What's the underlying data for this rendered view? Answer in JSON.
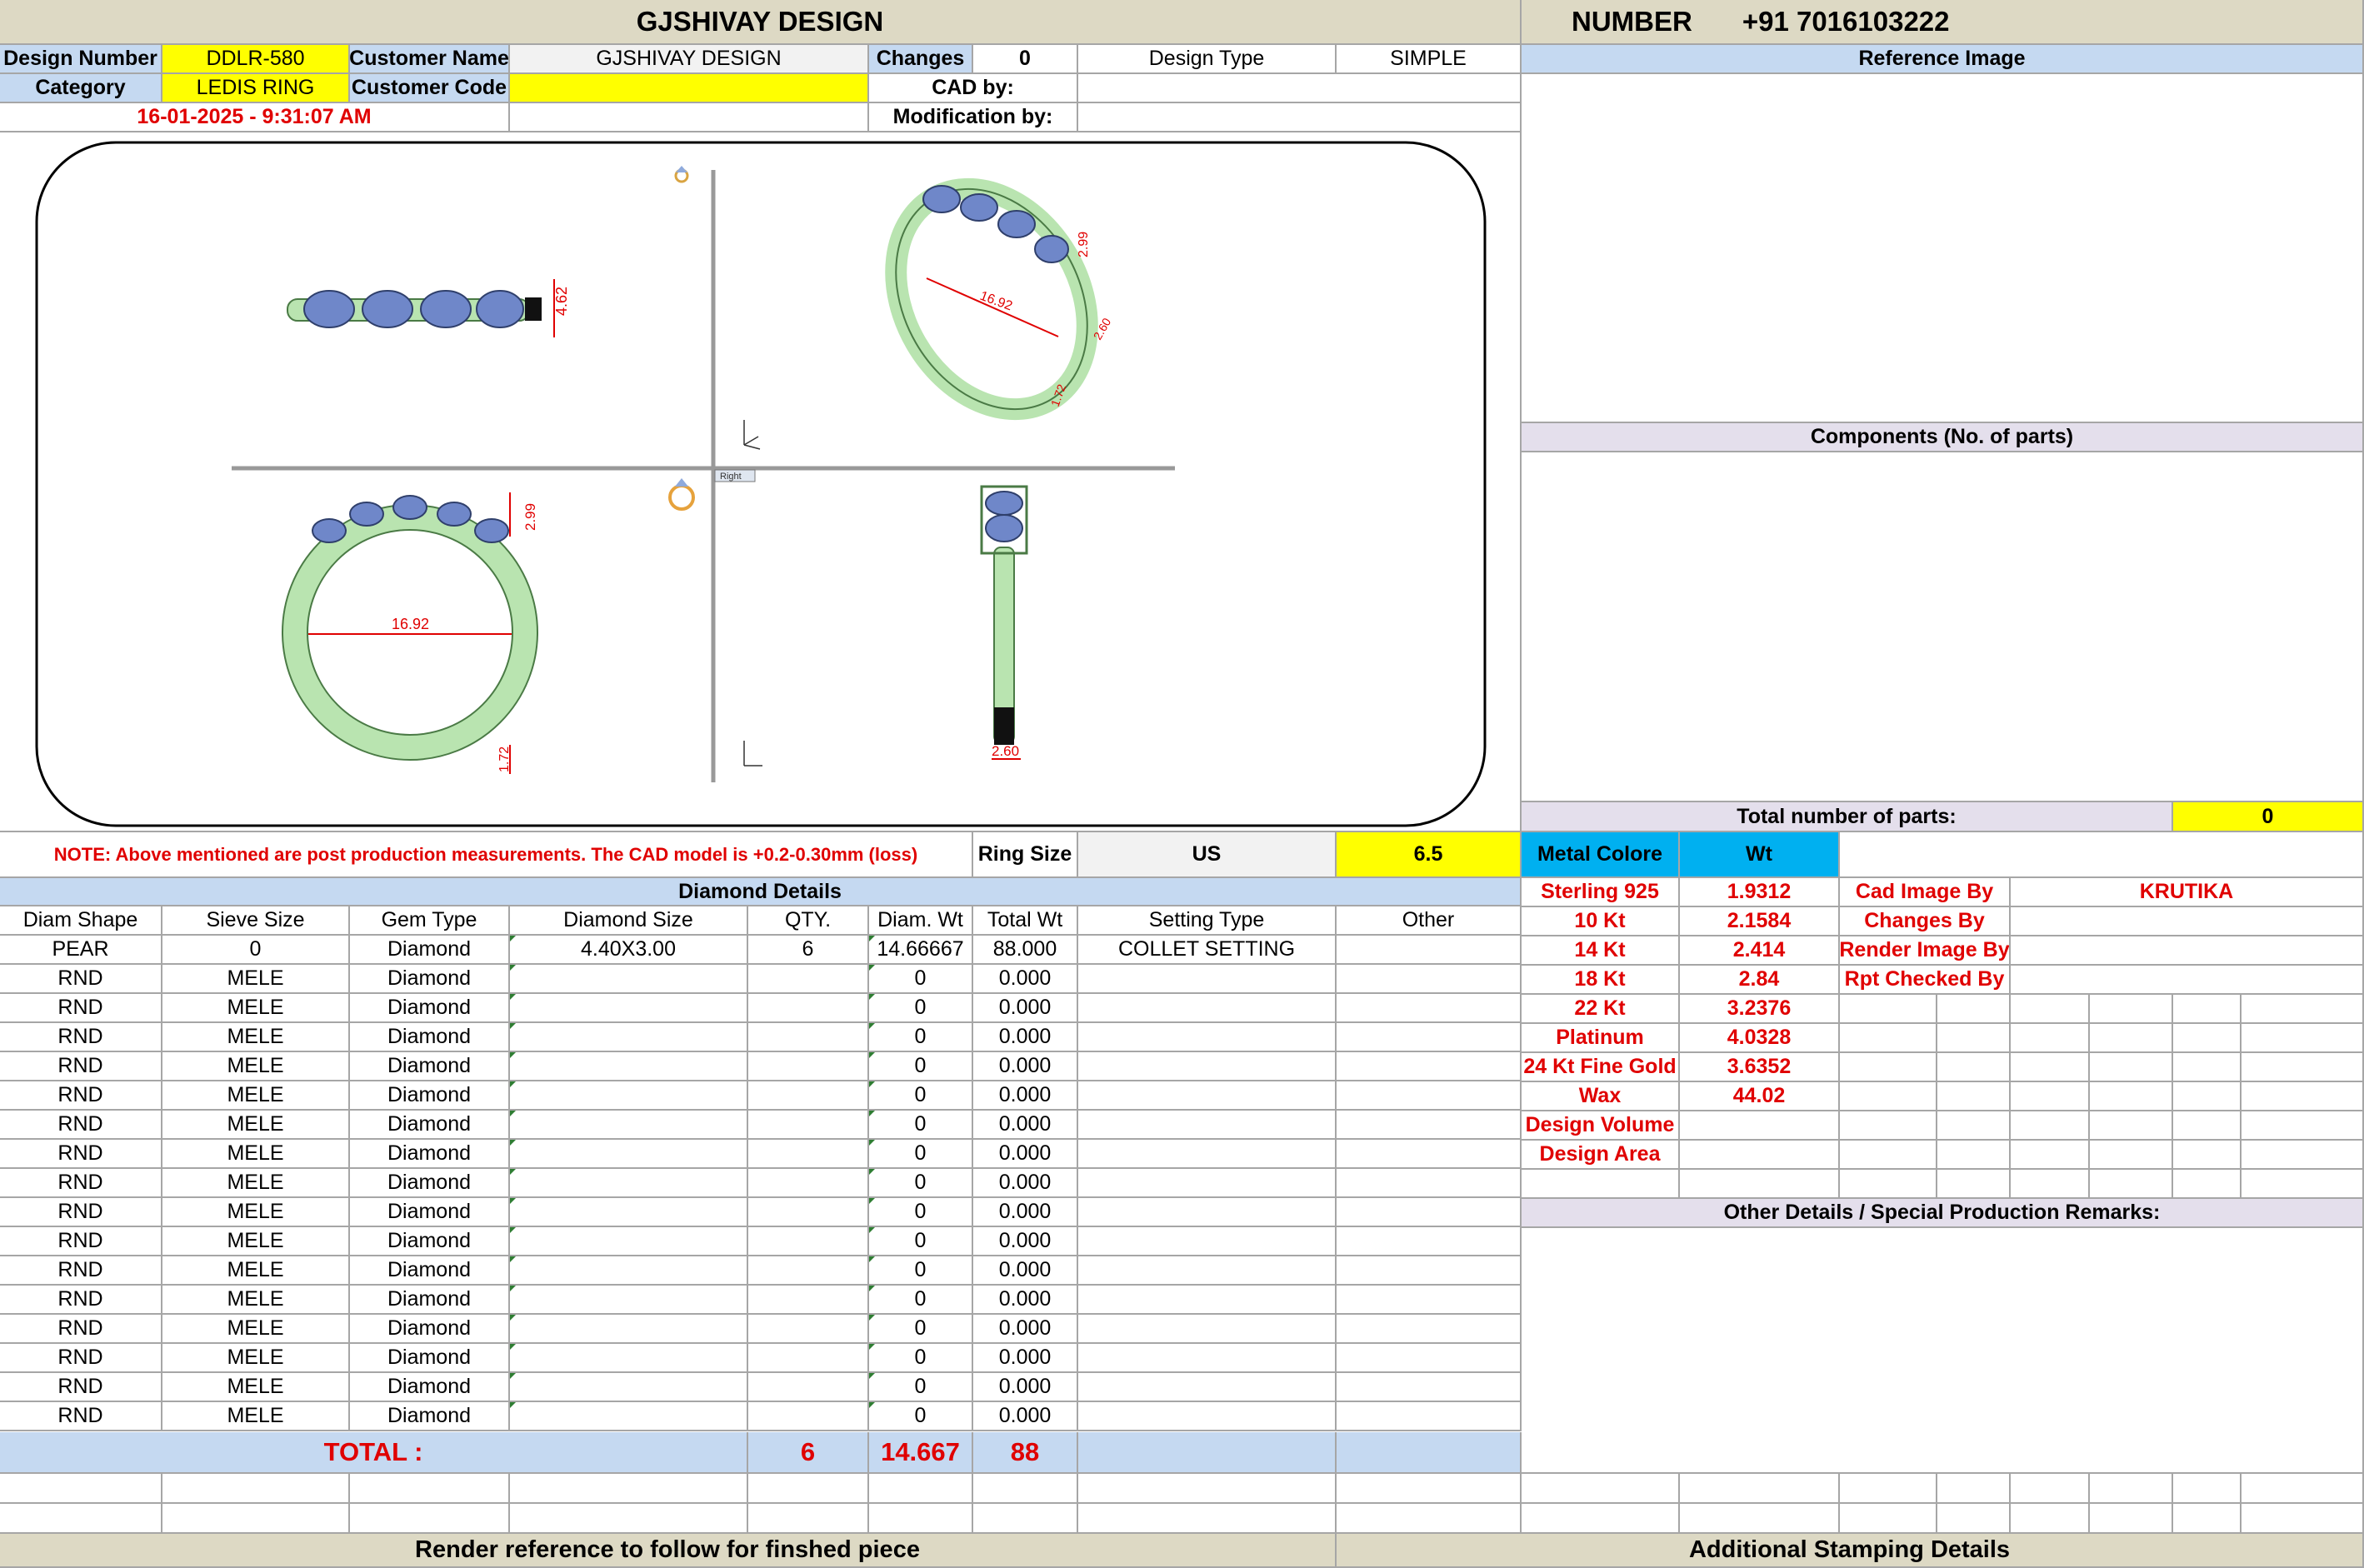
{
  "header": {
    "company": "GJSHIVAY DESIGN",
    "number_label": "NUMBER",
    "number_value": "+91 7016103222"
  },
  "info": {
    "design_number_label": "Design Number",
    "design_number": "DDLR-580",
    "customer_name_label": "Customer Name",
    "customer_name": "GJSHIVAY DESIGN",
    "changes_label": "Changes",
    "changes": "0",
    "design_type_label": "Design Type",
    "design_type": "SIMPLE",
    "category_label": "Category",
    "category": "LEDIS RING",
    "customer_code_label": "Customer Code",
    "cad_by_label": "CAD by:",
    "datetime": "16-01-2025 - 9:31:07 AM",
    "modification_by_label": "Modification by:"
  },
  "right_panel": {
    "reference_image": "Reference Image",
    "components": "Components (No. of parts)",
    "total_parts_label": "Total number of parts:",
    "total_parts": "0"
  },
  "drawing": {
    "dim_side_height": "4.62",
    "dim_persp_width": "16.92",
    "dim_persp_height": "2.99",
    "dim_persp_small": "2.60",
    "dim_persp_bottom": "1.72",
    "dim_front_diameter": "16.92",
    "dim_front_height": "2.99",
    "dim_front_bottom": "1.72",
    "dim_right_width": "2.60",
    "view_label": "Right"
  },
  "note": {
    "text": "NOTE: Above mentioned are post production measurements. The CAD model is +0.2-0.30mm (loss)",
    "ring_size_label": "Ring Size",
    "ring_size_unit": "US",
    "ring_size": "6.5"
  },
  "diamond": {
    "title": "Diamond Details",
    "headers": [
      "Diam Shape",
      "Sieve Size",
      "Gem Type",
      "Diamond Size",
      "QTY.",
      "Diam. Wt",
      "Total Wt",
      "Setting Type",
      "Other"
    ],
    "rows": [
      [
        "PEAR",
        "0",
        "Diamond",
        "4.40X3.00",
        "6",
        "14.66667",
        "88.000",
        "COLLET SETTING",
        ""
      ],
      [
        "RND",
        "MELE",
        "Diamond",
        "",
        "",
        "0",
        "0.000",
        "",
        ""
      ],
      [
        "RND",
        "MELE",
        "Diamond",
        "",
        "",
        "0",
        "0.000",
        "",
        ""
      ],
      [
        "RND",
        "MELE",
        "Diamond",
        "",
        "",
        "0",
        "0.000",
        "",
        ""
      ],
      [
        "RND",
        "MELE",
        "Diamond",
        "",
        "",
        "0",
        "0.000",
        "",
        ""
      ],
      [
        "RND",
        "MELE",
        "Diamond",
        "",
        "",
        "0",
        "0.000",
        "",
        ""
      ],
      [
        "RND",
        "MELE",
        "Diamond",
        "",
        "",
        "0",
        "0.000",
        "",
        ""
      ],
      [
        "RND",
        "MELE",
        "Diamond",
        "",
        "",
        "0",
        "0.000",
        "",
        ""
      ],
      [
        "RND",
        "MELE",
        "Diamond",
        "",
        "",
        "0",
        "0.000",
        "",
        ""
      ],
      [
        "RND",
        "MELE",
        "Diamond",
        "",
        "",
        "0",
        "0.000",
        "",
        ""
      ],
      [
        "RND",
        "MELE",
        "Diamond",
        "",
        "",
        "0",
        "0.000",
        "",
        ""
      ],
      [
        "RND",
        "MELE",
        "Diamond",
        "",
        "",
        "0",
        "0.000",
        "",
        ""
      ],
      [
        "RND",
        "MELE",
        "Diamond",
        "",
        "",
        "0",
        "0.000",
        "",
        ""
      ],
      [
        "RND",
        "MELE",
        "Diamond",
        "",
        "",
        "0",
        "0.000",
        "",
        ""
      ],
      [
        "RND",
        "MELE",
        "Diamond",
        "",
        "",
        "0",
        "0.000",
        "",
        ""
      ],
      [
        "RND",
        "MELE",
        "Diamond",
        "",
        "",
        "0",
        "0.000",
        "",
        ""
      ],
      [
        "RND",
        "MELE",
        "Diamond",
        "",
        "",
        "0",
        "0.000",
        "",
        ""
      ]
    ],
    "total_label": "TOTAL :",
    "total_qty": "6",
    "total_diam_wt": "14.667",
    "total_wt": "88"
  },
  "metal": {
    "color_label": "Metal Colore",
    "wt_label": "Wt",
    "rows": [
      [
        "Sterling 925",
        "1.9312"
      ],
      [
        "10 Kt",
        "2.1584"
      ],
      [
        "14 Kt",
        "2.414"
      ],
      [
        "18 Kt",
        "2.84"
      ],
      [
        "22 Kt",
        "3.2376"
      ],
      [
        "Platinum",
        "4.0328"
      ],
      [
        "24 Kt Fine Gold",
        "3.6352"
      ],
      [
        "Wax",
        "44.02"
      ],
      [
        "Design Volume",
        ""
      ],
      [
        "Design Area",
        ""
      ]
    ]
  },
  "credits": {
    "cad_image_by_label": "Cad Image By",
    "cad_image_by": "KRUTIKA",
    "changes_by_label": "Changes By",
    "render_image_by_label": "Render Image By",
    "rpt_checked_by_label": "Rpt Checked By"
  },
  "other_details": "Other Details / Special Production Remarks:",
  "footer": {
    "render_reference": "Render reference to follow for finshed piece",
    "stamping": "Additional Stamping Details"
  },
  "colors": {
    "header_beige": "#ddd9c4",
    "highlight_yellow": "#ffff00",
    "section_blue": "#c5d9f1",
    "metal_blue": "#00b0f0",
    "text_red": "#e00000",
    "ring_green": "#b9e4b0",
    "stone_blue": "#6f87c9"
  }
}
